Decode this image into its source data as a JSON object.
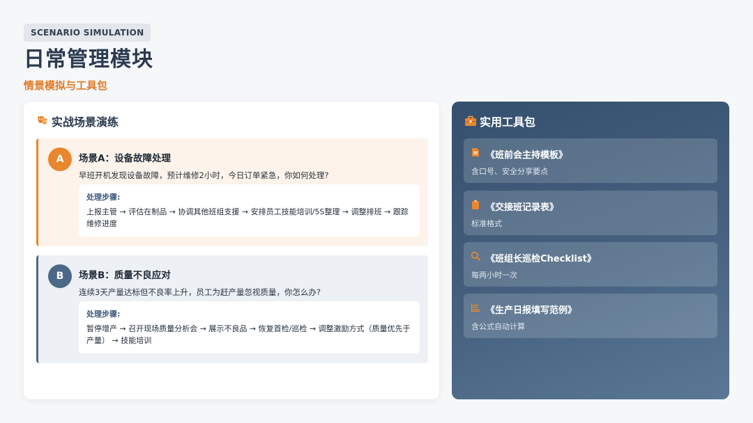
{
  "header": {
    "tag": "SCENARIO SIMULATION",
    "title": "日常管理模块",
    "subtitle": "情景模拟与工具包"
  },
  "colors": {
    "accent": "#e8872e",
    "navy": "#4b6886",
    "panel": "#3e5a78"
  },
  "scenarios_card": {
    "heading": "实战场景演练",
    "icon": "theater-masks-icon",
    "items": [
      {
        "badge": "A",
        "title": "场景A：设备故障处理",
        "description": "早班开机发现设备故障，预计维修2小时，今日订单紧急，你如何处理?",
        "steps_label": "处理步骤:",
        "steps": "上报主管 → 评估在制品 → 协调其他班组支援 → 安排员工技能培训/5S整理 → 调整排班 → 跟踪维修进度"
      },
      {
        "badge": "B",
        "title": "场景B：质量不良应对",
        "description": "连续3天产量达标但不良率上升，员工为赶产量忽视质量，你怎么办?",
        "steps_label": "处理步骤:",
        "steps": "暂停增产 → 召开现场质量分析会 → 展示不良品 → 恢复首检/巡检 → 调整激励方式（质量优先于产量） → 技能培训"
      }
    ]
  },
  "toolkit_card": {
    "heading": "实用工具包",
    "icon": "toolbox-icon",
    "items": [
      {
        "icon": "document-icon",
        "title": "《班前会主持模板》",
        "subtitle": "含口号、安全分享要点"
      },
      {
        "icon": "clipboard-icon",
        "title": "《交接班记录表》",
        "subtitle": "标准格式"
      },
      {
        "icon": "search-icon",
        "title": "《班组长巡检Checklist》",
        "subtitle": "每两小时一次"
      },
      {
        "icon": "list-icon",
        "title": "《生产日报填写范例》",
        "subtitle": "含公式自动计算"
      }
    ]
  }
}
